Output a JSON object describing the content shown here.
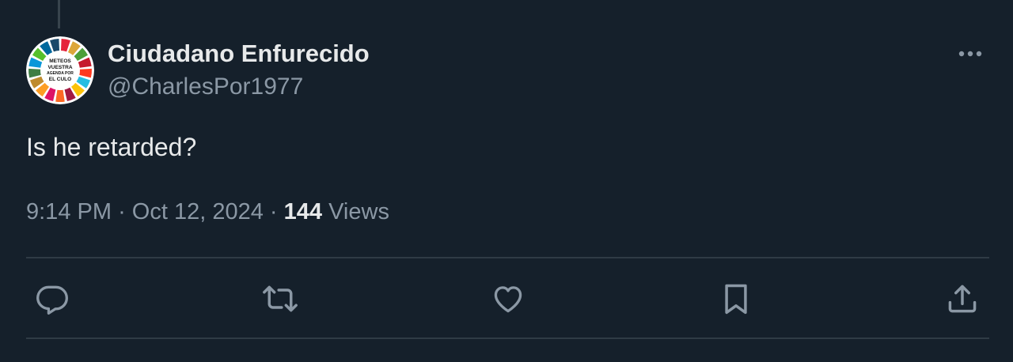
{
  "tweet": {
    "author": {
      "display_name": "Ciudadano Enfurecido",
      "handle": "@CharlesPor1977",
      "avatar_text": [
        "METEOS",
        "VUESTRA",
        "AGENDA POR",
        "EL CULO"
      ]
    },
    "text": "Is he retarded?",
    "time": "9:14 PM",
    "separator": "·",
    "date": "Oct 12, 2024",
    "views_count": "144",
    "views_label": "Views"
  },
  "icons": {
    "more": "more-horizontal-icon",
    "reply": "reply-icon",
    "retweet": "retweet-icon",
    "like": "heart-icon",
    "bookmark": "bookmark-icon",
    "share": "share-icon"
  },
  "colors": {
    "background": "#15202b",
    "text_primary": "#e7e9ea",
    "text_secondary": "#8b98a5",
    "divider": "#2f3b45",
    "icon": "#8b98a5"
  }
}
